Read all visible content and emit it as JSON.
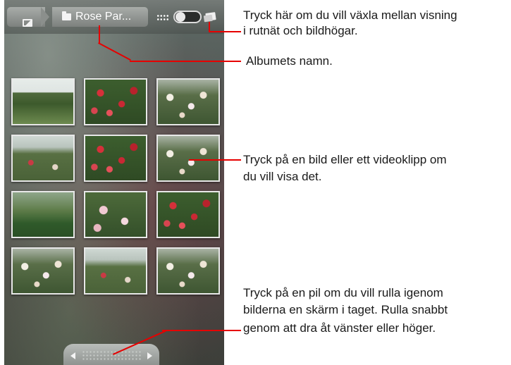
{
  "toolbar": {
    "home_icon": "gallery-icon",
    "album_icon": "folder-icon",
    "album_label": "Rose Par...",
    "grid_icon": "grid-view-icon",
    "stack_icon": "stack-view-icon"
  },
  "thumbnails": [
    {
      "row": 1,
      "col": 1,
      "subject": "rose garden with trees"
    },
    {
      "row": 1,
      "col": 2,
      "subject": "red roses"
    },
    {
      "row": 1,
      "col": 3,
      "subject": "white roses"
    },
    {
      "row": 2,
      "col": 1,
      "subject": "garden terrace"
    },
    {
      "row": 2,
      "col": 2,
      "subject": "red and orange roses"
    },
    {
      "row": 2,
      "col": 3,
      "subject": "rose bushes"
    },
    {
      "row": 3,
      "col": 1,
      "subject": "hedge and garden"
    },
    {
      "row": 3,
      "col": 2,
      "subject": "pink roses"
    },
    {
      "row": 3,
      "col": 3,
      "subject": "red roses path"
    },
    {
      "row": 4,
      "col": 1,
      "subject": "white and yellow roses"
    },
    {
      "row": 4,
      "col": 2,
      "subject": "garden lawn"
    },
    {
      "row": 4,
      "col": 3,
      "subject": "white roses"
    }
  ],
  "callouts": {
    "view_toggle_line1": "Tryck här om du vill växla mellan visning",
    "view_toggle_line2": "i rutnät och bildhögar.",
    "album_name": "Albumets namn.",
    "tap_image_line1": "Tryck på en bild eller ett videoklipp om",
    "tap_image_line2": "du vill visa det.",
    "pager_line1": "Tryck på en pil om du vill rulla igenom",
    "pager_line2": "bilderna en skärm i taget. Rulla snabbt",
    "pager_line3": "genom att dra åt vänster eller höger."
  },
  "colors": {
    "callout_line": "#e60000"
  }
}
